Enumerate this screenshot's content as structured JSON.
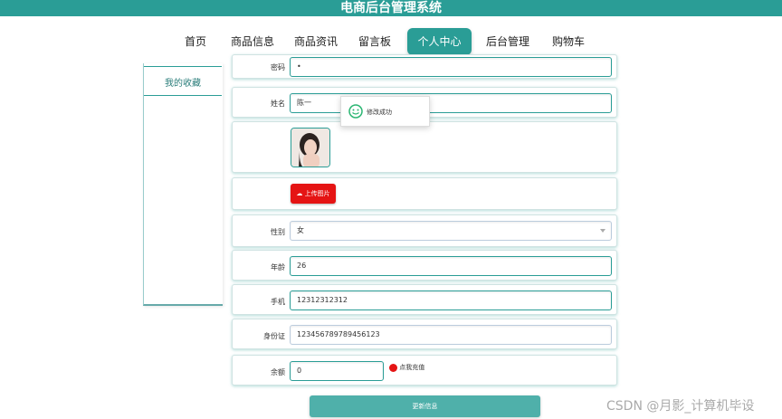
{
  "app": {
    "title": "电商后台管理系统"
  },
  "nav": {
    "items": [
      {
        "label": "首页"
      },
      {
        "label": "商品信息"
      },
      {
        "label": "商品资讯"
      },
      {
        "label": "留言板"
      },
      {
        "label": "个人中心",
        "active": true
      },
      {
        "label": "后台管理"
      },
      {
        "label": "购物车"
      }
    ]
  },
  "sidebar": {
    "items": [
      {
        "label": "我的收藏"
      }
    ]
  },
  "form": {
    "top_cut": {
      "label": "密码",
      "value": "•"
    },
    "name": {
      "label": "姓名",
      "value": "陈一"
    },
    "upload_button": "上传图片",
    "gender": {
      "label": "性别",
      "value": "女"
    },
    "age": {
      "label": "年龄",
      "value": "26"
    },
    "phone": {
      "label": "手机",
      "value": "12312312312"
    },
    "id_card": {
      "label": "身份证",
      "value": "123456789789456123"
    },
    "balance": {
      "label": "余额",
      "value": "0",
      "recharge_link": "点我充值"
    },
    "submit": "更新信息"
  },
  "toast": {
    "message": "修改成功"
  },
  "watermark": "CSDN @月影_计算机毕设",
  "colors": {
    "primary": "#2a9d96",
    "upload": "#e51414",
    "submit": "#4fb0aa"
  }
}
